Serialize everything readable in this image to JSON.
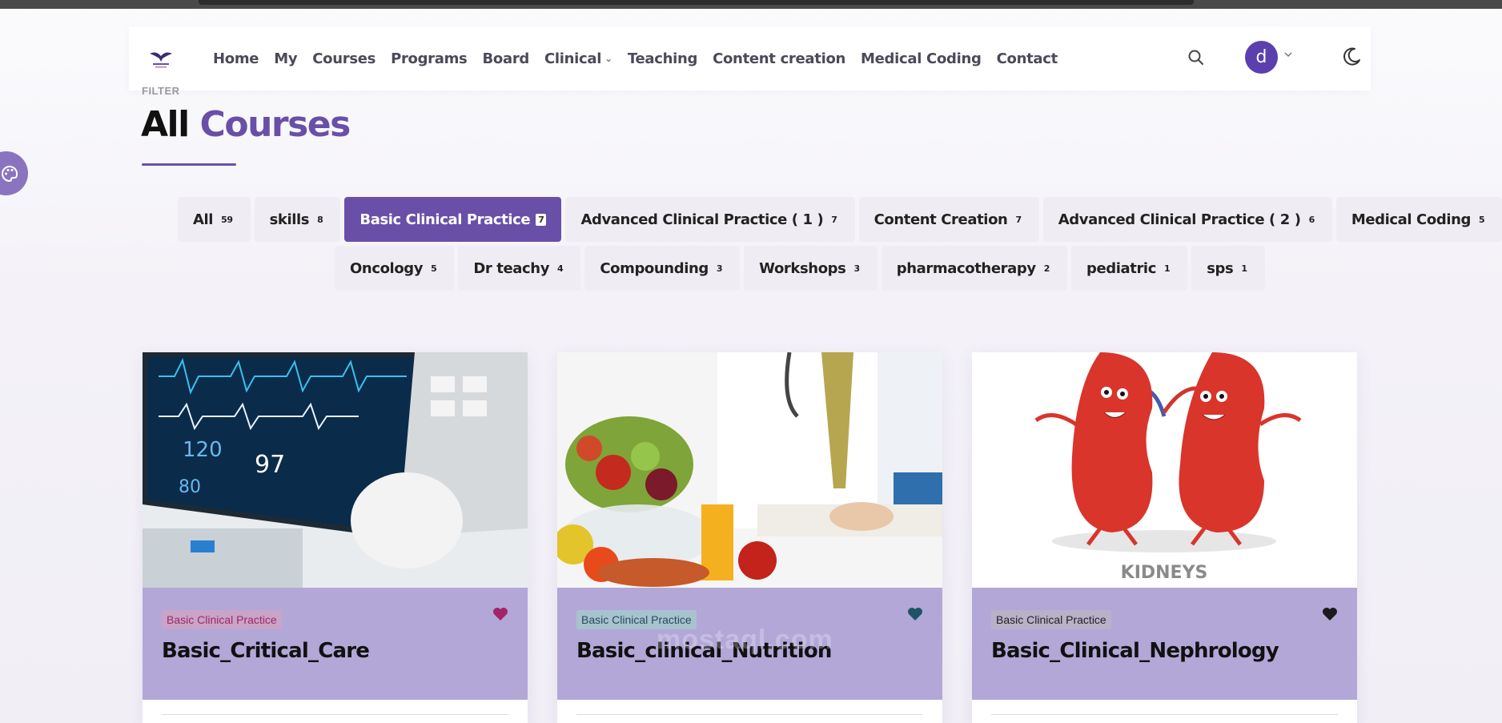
{
  "nav": {
    "logo_icon": "brand-bird-logo",
    "links": [
      "Home",
      "My",
      "Courses",
      "Programs",
      "Board",
      "Clinical",
      "Teaching",
      "Content creation",
      "Medical Coding",
      "Contact"
    ],
    "avatar_letter": "d",
    "colors": {
      "accent": "#5b3fae"
    }
  },
  "page": {
    "filter_label": "FILTER",
    "title_part1": "All",
    "title_part2": "Courses",
    "accent_color": "#6a4fa8"
  },
  "filters": {
    "row1": [
      {
        "label": "All",
        "count": "59",
        "active": false
      },
      {
        "label": "skills",
        "count": "8",
        "active": false
      },
      {
        "label": "Basic Clinical Practice",
        "count": "7",
        "active": true
      },
      {
        "label": "Advanced Clinical Practice ( 1 )",
        "count": "7",
        "active": false
      },
      {
        "label": "Content Creation",
        "count": "7",
        "active": false
      },
      {
        "label": "Advanced Clinical Practice ( 2 )",
        "count": "6",
        "active": false
      },
      {
        "label": "Medical Coding",
        "count": "5",
        "active": false
      }
    ],
    "row2": [
      {
        "label": "Oncology",
        "count": "5",
        "active": false
      },
      {
        "label": "Dr teachy",
        "count": "4",
        "active": false
      },
      {
        "label": "Compounding",
        "count": "3",
        "active": false
      },
      {
        "label": "Workshops",
        "count": "3",
        "active": false
      },
      {
        "label": "pharmacotherapy",
        "count": "2",
        "active": false
      },
      {
        "label": "pediatric",
        "count": "1",
        "active": false
      },
      {
        "label": "sps",
        "count": "1",
        "active": false
      }
    ]
  },
  "cards": [
    {
      "tag": "Basic Clinical Practice",
      "title": "Basic_Critical_Care",
      "tag_color": "#9c2a63",
      "tag_bg": "#c9a4c8",
      "heart_color": "#a3246a",
      "image": "patient-monitor-image"
    },
    {
      "tag": "Basic Clinical Practice",
      "title": "Basic_clinical_Nutrition",
      "tag_color": "#1f4d5a",
      "tag_bg": "#a9c2cf",
      "heart_color": "#1e5566",
      "image": "doctor-fruits-image"
    },
    {
      "tag": "Basic Clinical Practice",
      "title": "Basic_Clinical_Nephrology",
      "tag_color": "#222222",
      "tag_bg": "#b9b1c9",
      "heart_color": "#1b1b1b",
      "image": "kidneys-cartoon-image",
      "image_caption": "KIDNEYS"
    }
  ],
  "watermark": "mostaql.com"
}
